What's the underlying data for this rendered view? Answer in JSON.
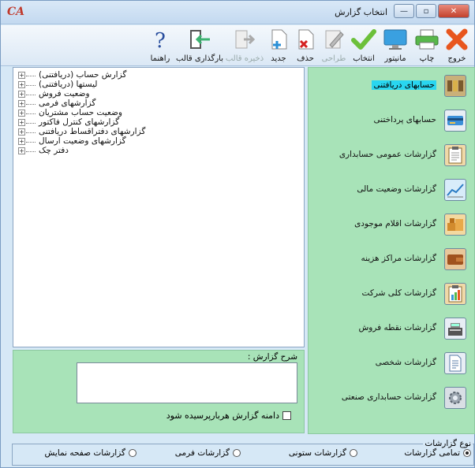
{
  "window": {
    "title": "انتخاب گزارش",
    "app_logo": "CA",
    "minimize_label": "—",
    "restore_label": "▫",
    "close_label": "✕"
  },
  "toolbar": {
    "items": [
      {
        "label": "خروج",
        "icon": "exit-x-icon",
        "enabled": true
      },
      {
        "label": "چاپ",
        "icon": "printer-icon",
        "enabled": true
      },
      {
        "label": "مانیتور",
        "icon": "monitor-icon",
        "enabled": true
      },
      {
        "label": "انتخاب",
        "icon": "checkmark-icon",
        "enabled": true
      },
      {
        "label": "طراحی",
        "icon": "design-pen-icon",
        "enabled": false
      },
      {
        "label": "حذف",
        "icon": "delete-doc-icon",
        "enabled": true
      },
      {
        "label": "جدید",
        "icon": "new-doc-icon",
        "enabled": true
      },
      {
        "label": "ذخیره قالب",
        "icon": "save-template-icon",
        "enabled": false
      },
      {
        "label": "بارگذاری قالب",
        "icon": "load-template-icon",
        "enabled": true
      },
      {
        "label": "راهنما",
        "icon": "help-question-icon",
        "enabled": true
      }
    ]
  },
  "tree": {
    "items": [
      "گزارش حساب (دریافتنی)",
      "لیستها (دریافتنی)",
      "وضعیت فروش",
      "گزارشهای فرمی",
      "وضعیت حساب مشتریان",
      "گزارشهای کنترل فاکتور",
      "گزارشهای دفتراقساط دریافتنی",
      "گزارشهای وضعیت ارسال",
      "دفتر چک"
    ],
    "expander": "+"
  },
  "nav": {
    "items": [
      {
        "label": "حسابهای دریافتنی",
        "icon": "receivables-icon",
        "selected": true
      },
      {
        "label": "حسابهای پرداختنی",
        "icon": "payables-icon",
        "selected": false
      },
      {
        "label": "گزارشات عمومی حسابداری",
        "icon": "clipboard-icon",
        "selected": false
      },
      {
        "label": "گزارشات وضعیت مالی",
        "icon": "chart-line-icon",
        "selected": false
      },
      {
        "label": "گزارشات اقلام موجودی",
        "icon": "inventory-boxes-icon",
        "selected": false
      },
      {
        "label": "گزارشات مراکز هزینه",
        "icon": "wallet-icon",
        "selected": false
      },
      {
        "label": "گزارشات کلی شرکت",
        "icon": "company-clipboard-icon",
        "selected": false
      },
      {
        "label": "گزارشات نقطه فروش",
        "icon": "cash-register-icon",
        "selected": false
      },
      {
        "label": "گزارشات شخصی",
        "icon": "personal-doc-icon",
        "selected": false
      },
      {
        "label": "گزارشات حسابداری صنعتی",
        "icon": "gear-icon",
        "selected": false
      }
    ]
  },
  "description": {
    "title": "شرح گزارش :",
    "value": "",
    "checkbox_label": "دامنه گزارش هربارپرسیده شود",
    "checkbox_checked": false
  },
  "report_type": {
    "title": "نوع گزارشات",
    "options": [
      {
        "label": "تمامی گزارشات",
        "selected": true
      },
      {
        "label": "گزارشات ستونی",
        "selected": false
      },
      {
        "label": "گزارشات فرمی",
        "selected": false
      },
      {
        "label": "گزارشات صفحه نمایش",
        "selected": false
      }
    ]
  },
  "colors": {
    "panel_green": "#a8e3b8",
    "selected_highlight": "#29d6f0",
    "window_blue": "#d6e8f6"
  }
}
